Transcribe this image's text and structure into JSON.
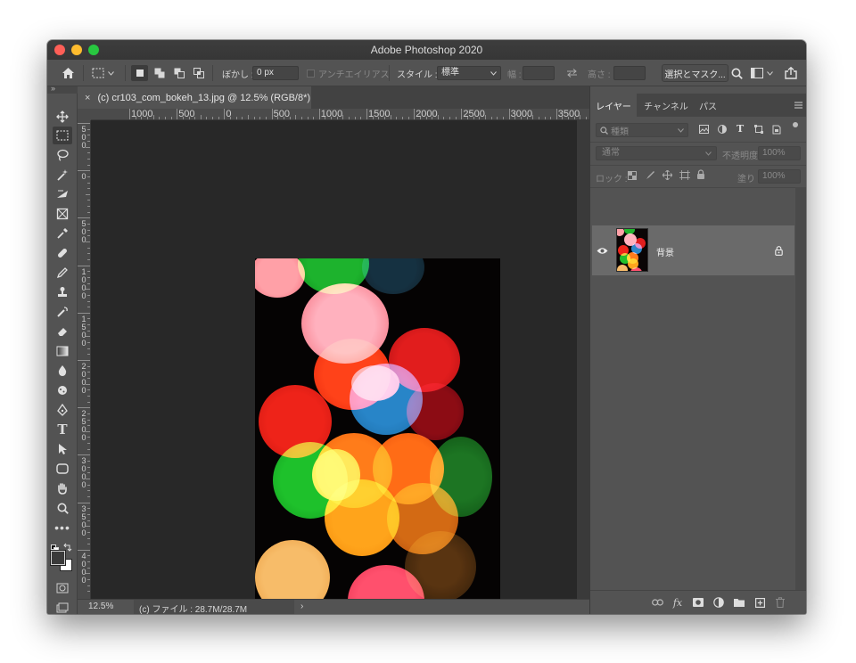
{
  "window": {
    "title": "Adobe Photoshop 2020"
  },
  "options_bar": {
    "feather_label": "ぼかし :",
    "feather_value": "0 px",
    "antialias_label": "アンチエイリアス",
    "style_label": "スタイル :",
    "style_value": "標準",
    "width_label": "幅 :",
    "height_label": "高さ :",
    "select_mask_button": "選択とマスク..."
  },
  "document": {
    "tab_title": "(c) cr103_com_bokeh_13.jpg @ 12.5% (RGB/8*)",
    "close_glyph": "×"
  },
  "rulers": {
    "top_labels": [
      "1000",
      "500",
      "0",
      "500",
      "1000",
      "1500",
      "2000",
      "2500",
      "3000",
      "3500"
    ],
    "left_labels": [
      "500",
      "0",
      "500",
      "1000",
      "1500",
      "2000",
      "2500",
      "3000",
      "3500",
      "4000"
    ]
  },
  "status_bar": {
    "zoom": "12.5%",
    "file_info": "(c) ファイル : 28.7M/28.7M",
    "arrow": "›"
  },
  "layers_panel": {
    "tabs": [
      "レイヤー",
      "チャンネル",
      "パス"
    ],
    "filter_placeholder": "種類",
    "blend_mode": "通常",
    "opacity_label": "不透明度 :",
    "opacity_value": "100%",
    "lock_label": "ロック :",
    "fill_label": "塗り :",
    "fill_value": "100%",
    "layers": [
      {
        "name": "背景",
        "visible": true,
        "locked": true
      }
    ]
  },
  "icons": {
    "home": "home-icon",
    "marquee": "rect-marquee-icon",
    "move": "move-icon",
    "lasso": "lasso-icon",
    "magic_wand": "magic-wand-icon",
    "search": "search-icon",
    "share": "share-icon",
    "eye": "eye-icon",
    "lock": "lock-icon"
  },
  "colors": {
    "ui_bg": "#535353",
    "ui_dark": "#424242",
    "canvas_bg": "#282828",
    "foreground_swatch": "#3a3a3a",
    "background_swatch": "#ffffff"
  }
}
